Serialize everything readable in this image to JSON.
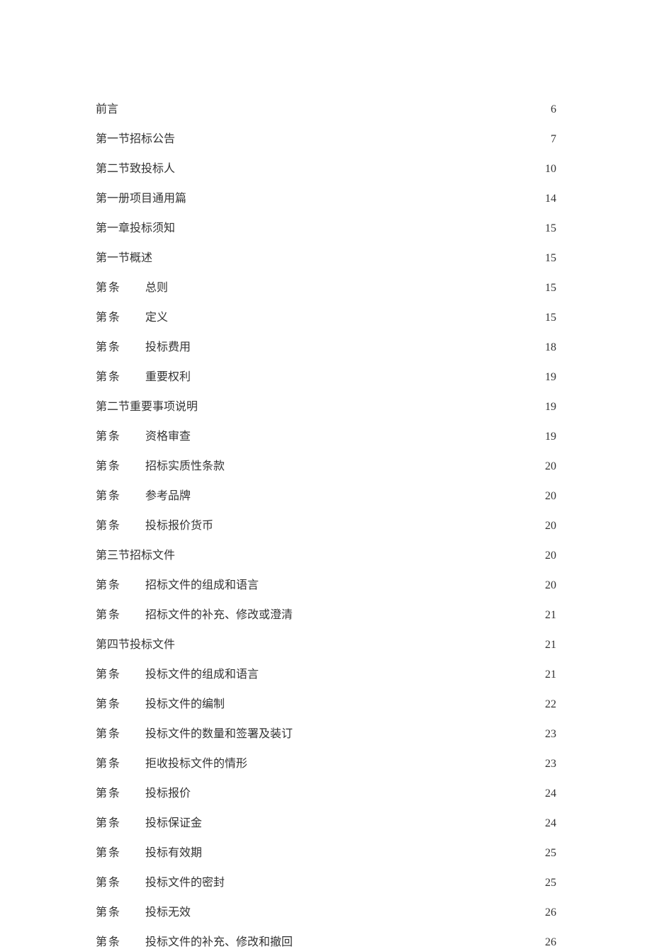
{
  "toc": [
    {
      "indent": false,
      "prefix": "",
      "label": "前言",
      "page": "6"
    },
    {
      "indent": false,
      "prefix": "",
      "label": "第一节招标公告",
      "page": "7"
    },
    {
      "indent": false,
      "prefix": "",
      "label": "第二节致投标人",
      "page": "10"
    },
    {
      "indent": false,
      "prefix": "",
      "label": "第一册项目通用篇",
      "page": "14"
    },
    {
      "indent": false,
      "prefix": "",
      "label": "第一章投标须知",
      "page": "15"
    },
    {
      "indent": false,
      "prefix": "",
      "label": "第一节概述",
      "page": "15"
    },
    {
      "indent": true,
      "prefix": "第条",
      "label": "总则",
      "page": "15"
    },
    {
      "indent": true,
      "prefix": "第条",
      "label": "定义",
      "page": "15"
    },
    {
      "indent": true,
      "prefix": "第条",
      "label": "投标费用",
      "page": "18"
    },
    {
      "indent": true,
      "prefix": "第条",
      "label": "重要权利",
      "page": "19"
    },
    {
      "indent": false,
      "prefix": "",
      "label": "第二节重要事项说明",
      "page": "19"
    },
    {
      "indent": true,
      "prefix": "第条",
      "label": "资格审查",
      "page": "19"
    },
    {
      "indent": true,
      "prefix": "第条",
      "label": "招标实质性条款",
      "page": "20"
    },
    {
      "indent": true,
      "prefix": "第条",
      "label": "参考品牌",
      "page": "20"
    },
    {
      "indent": true,
      "prefix": "第条",
      "label": "投标报价货币",
      "page": "20"
    },
    {
      "indent": false,
      "prefix": "",
      "label": "第三节招标文件",
      "page": "20"
    },
    {
      "indent": true,
      "prefix": "第条",
      "label": "招标文件的组成和语言",
      "page": "20"
    },
    {
      "indent": true,
      "prefix": "第条",
      "label": "招标文件的补充、修改或澄清",
      "page": "21"
    },
    {
      "indent": false,
      "prefix": "",
      "label": "第四节投标文件",
      "page": "21"
    },
    {
      "indent": true,
      "prefix": "第条",
      "label": "投标文件的组成和语言",
      "page": "21"
    },
    {
      "indent": true,
      "prefix": "第条",
      "label": "投标文件的编制",
      "page": "22"
    },
    {
      "indent": true,
      "prefix": "第条",
      "label": "投标文件的数量和签署及装订",
      "page": "23"
    },
    {
      "indent": true,
      "prefix": "第条",
      "label": "拒收投标文件的情形",
      "page": "23"
    },
    {
      "indent": true,
      "prefix": "第条",
      "label": "投标报价",
      "page": "24"
    },
    {
      "indent": true,
      "prefix": "第条",
      "label": "投标保证金",
      "page": "24"
    },
    {
      "indent": true,
      "prefix": "第条",
      "label": "投标有效期",
      "page": "25"
    },
    {
      "indent": true,
      "prefix": "第条",
      "label": "投标文件的密封",
      "page": "25"
    },
    {
      "indent": true,
      "prefix": "第条",
      "label": "投标无效",
      "page": "26"
    },
    {
      "indent": true,
      "prefix": "第条",
      "label": "投标文件的补充、修改和撤回",
      "page": "26"
    }
  ]
}
